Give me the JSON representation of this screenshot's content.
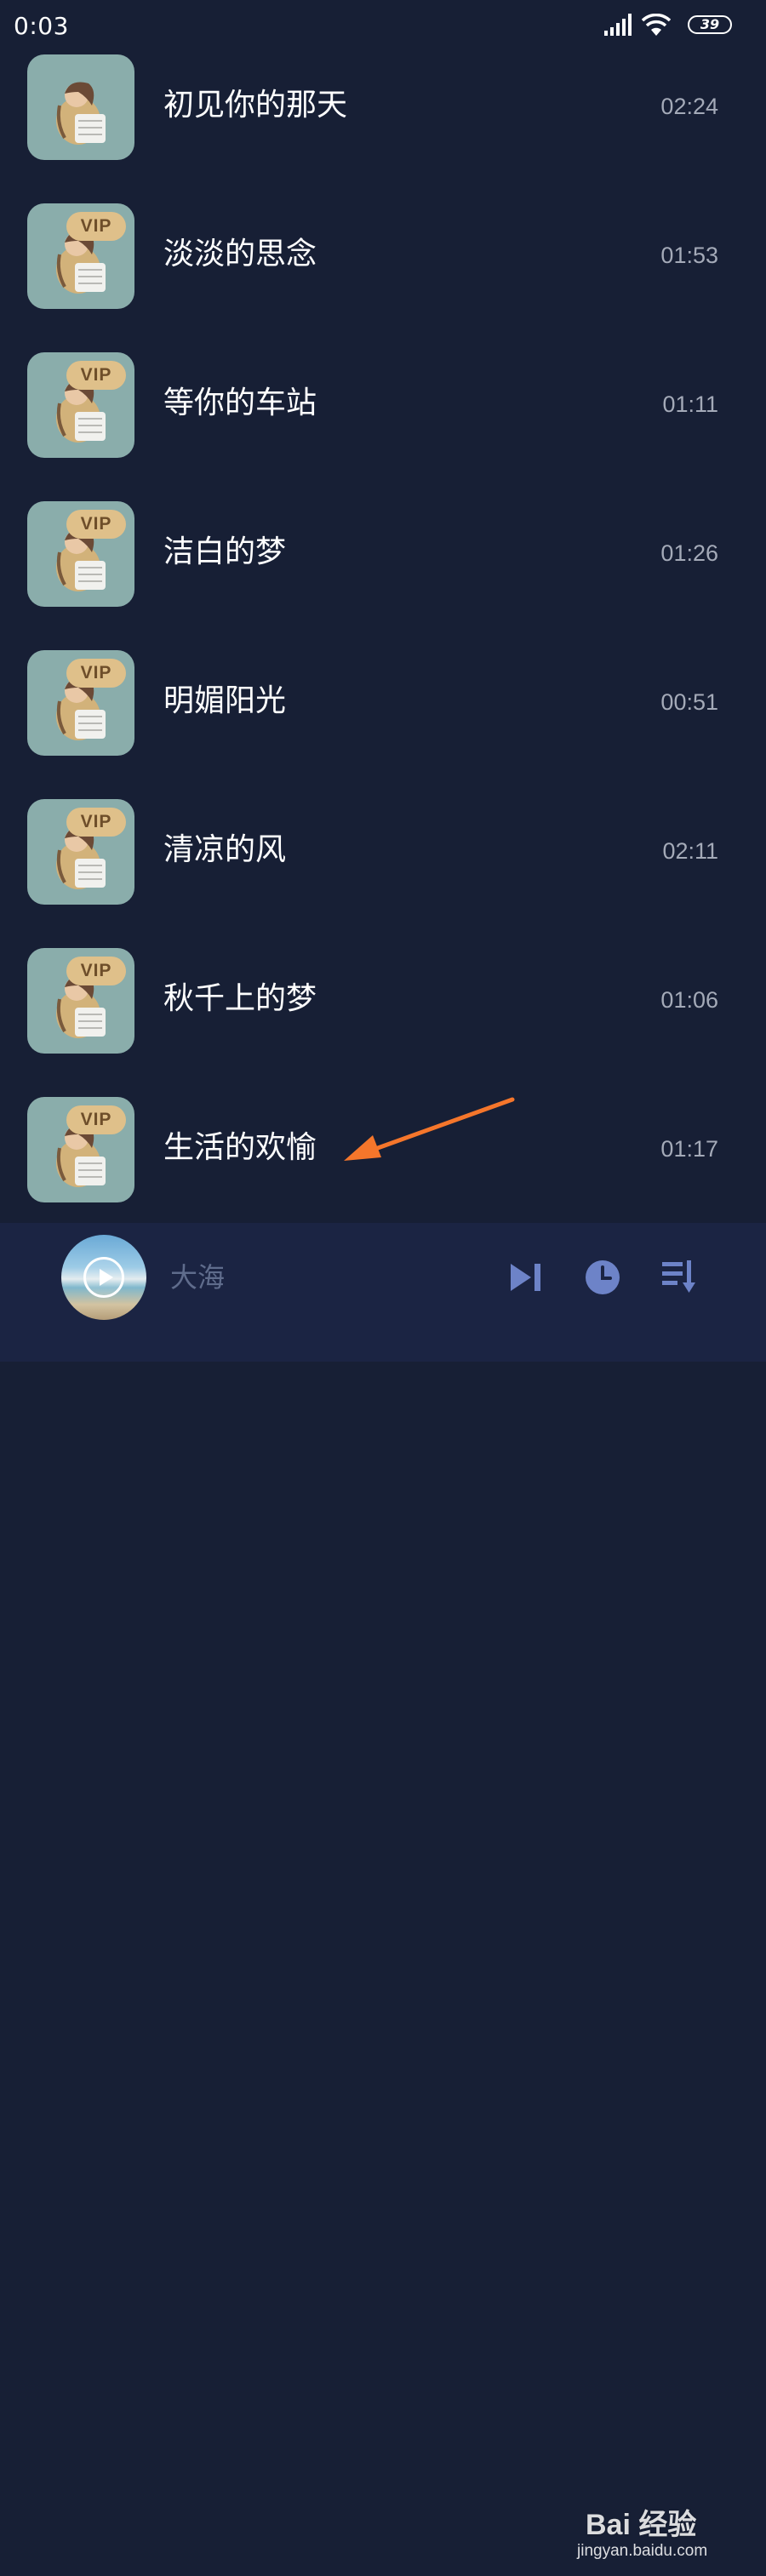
{
  "status_bar": {
    "time": "0:03",
    "battery": "39",
    "icons": [
      "signal-icon",
      "wifi-icon",
      "battery-icon"
    ]
  },
  "songs": [
    {
      "title": "初见你的那天",
      "duration": "02:24",
      "vip": false
    },
    {
      "title": "淡淡的思念",
      "duration": "01:53",
      "vip": true,
      "badge": "VIP"
    },
    {
      "title": "等你的车站",
      "duration": "01:11",
      "vip": true,
      "badge": "VIP"
    },
    {
      "title": "洁白的梦",
      "duration": "01:26",
      "vip": true,
      "badge": "VIP"
    },
    {
      "title": "明媚阳光",
      "duration": "00:51",
      "vip": true,
      "badge": "VIP"
    },
    {
      "title": "清凉的风",
      "duration": "02:11",
      "vip": true,
      "badge": "VIP"
    },
    {
      "title": "秋千上的梦",
      "duration": "01:06",
      "vip": true,
      "badge": "VIP"
    },
    {
      "title": "生活的欢愉",
      "duration": "01:17",
      "vip": true,
      "badge": "VIP"
    }
  ],
  "player": {
    "title": "大海",
    "controls": [
      "next-icon",
      "timer-icon",
      "playlist-icon"
    ]
  },
  "watermark": {
    "logo": "Bai 经验",
    "url": "jingyan.baidu.com"
  },
  "colors": {
    "background": "#171f35",
    "player_bar": "#1b2443",
    "cover": "#8aadab",
    "vip_badge": "#dfc08a",
    "control_icon": "#6d83c8",
    "annotation_arrow": "#f5762b"
  }
}
